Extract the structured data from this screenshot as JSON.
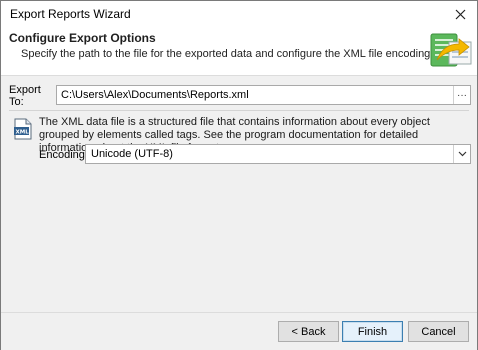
{
  "window": {
    "title": "Export Reports Wizard"
  },
  "header": {
    "title": "Configure Export Options",
    "subtitle": "Specify the path to the file for the exported data and configure the XML file encoding."
  },
  "export": {
    "label": "Export To:",
    "path": "C:\\Users\\Alex\\Documents\\Reports.xml",
    "browse_label": "···"
  },
  "description": "The XML data file is a structured file that contains information about every object grouped by elements called tags. See the program documentation for detailed information about the XML file format.",
  "encoding": {
    "label": "Encoding:",
    "value": "Unicode (UTF-8)"
  },
  "buttons": {
    "back": "< Back",
    "finish": "Finish",
    "cancel": "Cancel"
  },
  "icons": {
    "close": "close-icon",
    "wizard": "export-sheet-icon",
    "xml": "xml-file-icon",
    "dropdown": "chevron-down-icon"
  },
  "colors": {
    "accent_green": "#5cb85c",
    "accent_yellow": "#f5b800",
    "button_default_border": "#3c7fb1"
  }
}
